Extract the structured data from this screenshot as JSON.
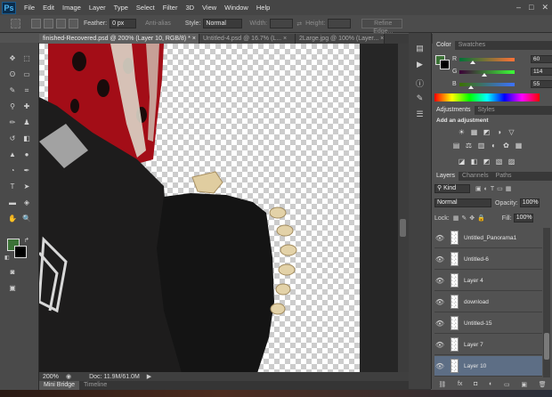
{
  "app": {
    "logo": "Ps"
  },
  "menu": [
    "File",
    "Edit",
    "Image",
    "Layer",
    "Type",
    "Select",
    "Filter",
    "3D",
    "View",
    "Window",
    "Help"
  ],
  "window_controls": {
    "minimize": "–",
    "maximize": "□",
    "close": "✕"
  },
  "options_bar": {
    "feather_label": "Feather:",
    "feather_value": "0 px",
    "anti_alias_label": "Anti-alias",
    "style_label": "Style:",
    "style_value": "Normal",
    "width_label": "Width:",
    "height_label": "Height:",
    "refine_edge_label": "Refine Edge..."
  },
  "document_tabs": [
    {
      "label": "finished-Recovered.psd @ 200% (Layer 10, RGB/8) *",
      "close": "×",
      "active": true
    },
    {
      "label": "Untitled-4.psd @ 16.7% (L...",
      "close": "×",
      "active": false
    },
    {
      "label": "2Large.jpg @ 100% (Layer...",
      "close": "×",
      "active": false
    }
  ],
  "status_bar": {
    "zoom": "200%",
    "doc_info": "Doc: 11.9M/61.0M"
  },
  "bottom_tabs": [
    {
      "label": "Mini Bridge",
      "active": true
    },
    {
      "label": "Timeline",
      "active": false
    }
  ],
  "color_panel": {
    "tabs": [
      {
        "label": "Color",
        "active": true
      },
      {
        "label": "Swatches",
        "active": false
      }
    ],
    "channels": [
      {
        "name": "R",
        "value": "60",
        "level": 0.235
      },
      {
        "name": "G",
        "value": "114",
        "level": 0.447
      },
      {
        "name": "B",
        "value": "55",
        "level": 0.216
      }
    ],
    "foreground": "#3c7237"
  },
  "adjustments_panel": {
    "tabs": [
      {
        "label": "Adjustments",
        "active": true
      },
      {
        "label": "Styles",
        "active": false
      }
    ],
    "heading": "Add an adjustment",
    "row1": [
      "☀",
      "▦",
      "◩",
      "◑",
      "▽"
    ],
    "row2": [
      "▤",
      "⚖",
      "▥",
      "◐",
      "✿",
      "▦"
    ],
    "row3": [
      "◪",
      "◧",
      "◩",
      "▧",
      "▨"
    ]
  },
  "layers_panel": {
    "tabs": [
      {
        "label": "Layers",
        "active": true
      },
      {
        "label": "Channels",
        "active": false
      },
      {
        "label": "Paths",
        "active": false
      }
    ],
    "filter_label": "Kind",
    "blend_mode": "Normal",
    "opacity_label": "Opacity:",
    "opacity_value": "100%",
    "lock_label": "Lock:",
    "fill_label": "Fill:",
    "fill_value": "100%",
    "layers": [
      {
        "name": "Untitled_Panorama1",
        "selected": false
      },
      {
        "name": "Untitled-6",
        "selected": false
      },
      {
        "name": "Layer 4",
        "selected": false
      },
      {
        "name": "download",
        "selected": false
      },
      {
        "name": "Untitled-15",
        "selected": false
      },
      {
        "name": "Layer 7",
        "selected": false
      },
      {
        "name": "Layer 10",
        "selected": true
      }
    ],
    "footer_icons": [
      "⛓",
      "fx",
      "◘",
      "◐",
      "▭",
      "▣",
      "🗑"
    ]
  },
  "colors": {
    "foreground": "#3c7237",
    "background": "#000000",
    "selection": "#5d6e85"
  }
}
